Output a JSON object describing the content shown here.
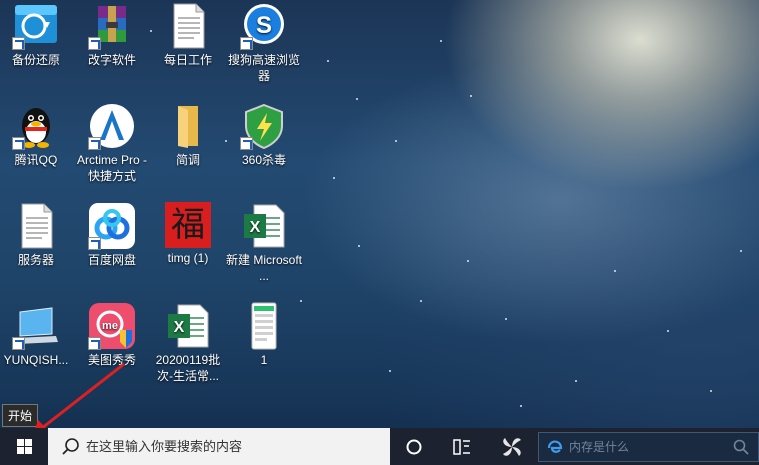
{
  "desktop": {
    "icons": [
      {
        "label": "备份还原",
        "icon": "backup-restore-icon"
      },
      {
        "label": "改字软件",
        "icon": "winrar-archive-icon"
      },
      {
        "label": "每日工作",
        "icon": "text-document-icon"
      },
      {
        "label": "搜狗高速浏览器",
        "icon": "sogou-browser-icon"
      },
      {
        "label": "腾讯QQ",
        "icon": "qq-penguin-icon"
      },
      {
        "label": "Arctime Pro - 快捷方式",
        "icon": "arctime-icon"
      },
      {
        "label": "简调",
        "icon": "folder-icon"
      },
      {
        "label": "360杀毒",
        "icon": "360-antivirus-icon"
      },
      {
        "label": "服务器",
        "icon": "text-document-icon"
      },
      {
        "label": "百度网盘",
        "icon": "baidu-netdisk-icon"
      },
      {
        "label": "timg (1)",
        "icon": "fu-image-icon"
      },
      {
        "label": "新建 Microsoft ...",
        "icon": "excel-icon"
      },
      {
        "label": "YUNQISH...",
        "icon": "computer-icon"
      },
      {
        "label": "美图秀秀",
        "icon": "meitu-icon"
      },
      {
        "label": "20200119批次-生活常...",
        "icon": "excel-icon"
      },
      {
        "label": "1",
        "icon": "phone-screenshot-icon"
      }
    ],
    "fu_char": "福"
  },
  "tooltip": {
    "text": "开始"
  },
  "taskbar": {
    "search_placeholder": "在这里输入你要搜索的内容",
    "ie_search_placeholder": "内存是什么"
  },
  "colors": {
    "taskbar": "#1c2230",
    "accent_arrow": "#e02020"
  }
}
